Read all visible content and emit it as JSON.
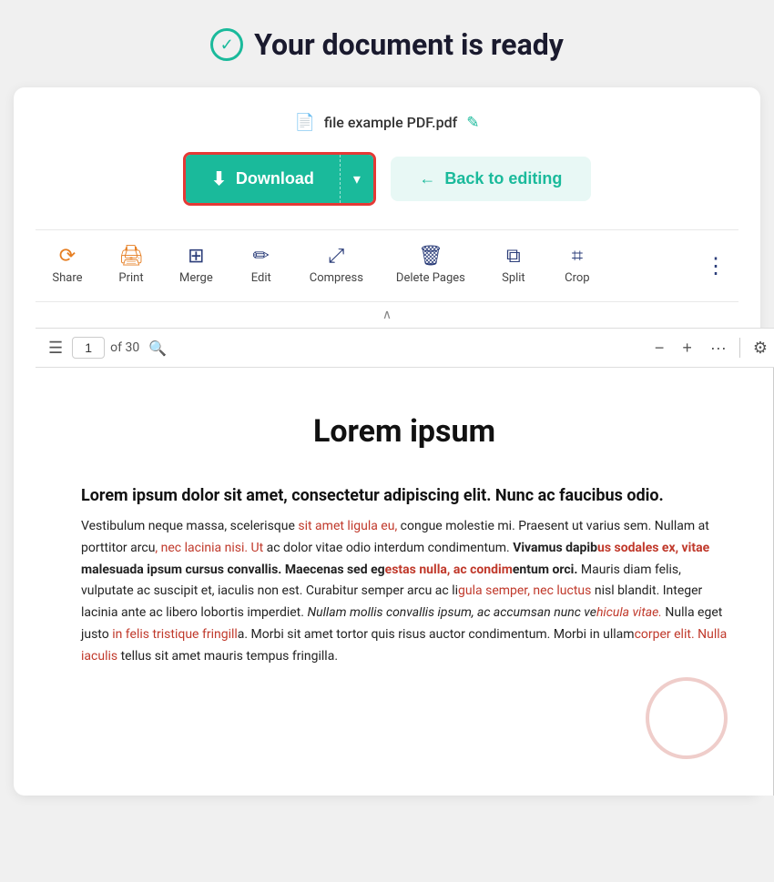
{
  "page": {
    "title": "Your document is ready"
  },
  "file": {
    "name": "file example PDF.pdf"
  },
  "buttons": {
    "download": "Download",
    "back_to_editing": "Back to editing"
  },
  "toolbar": {
    "items": [
      {
        "id": "share",
        "label": "Share",
        "icon_class": "share"
      },
      {
        "id": "print",
        "label": "Print",
        "icon_class": "print"
      },
      {
        "id": "merge",
        "label": "Merge",
        "icon_class": "merge"
      },
      {
        "id": "edit",
        "label": "Edit",
        "icon_class": "edit"
      },
      {
        "id": "compress",
        "label": "Compress",
        "icon_class": "compress"
      },
      {
        "id": "delete-pages",
        "label": "Delete Pages",
        "icon_class": "delete-pages"
      },
      {
        "id": "split",
        "label": "Split",
        "icon_class": "split"
      },
      {
        "id": "crop",
        "label": "Crop",
        "icon_class": "crop"
      }
    ]
  },
  "pdf_viewer": {
    "current_page": "1",
    "total_pages": "of 30",
    "content": {
      "title": "Lorem ipsum",
      "section_heading": "Lorem ipsum dolor sit amet, consectetur adipiscing elit. Nunc ac faucibus odio.",
      "paragraph": "Vestibulum neque massa, scelerisque sit amet ligula eu, congue molestie mi. Praesent ut varius sem. Nullam at porttitor arcu, nec lacinia nisi. Ut ac dolor vitae odio interdum condimentum. Vivamus dapibus sodales ex, vitae malesuada ipsum cursus convallis. Maecenas sed egestas nulla, ac condimentum orci. Mauris diam felis, vulputate ac suscipit et, iaculis non est. Curabitur semper arcu ac ligula semper, nec luctus nisl blandit. Integer lacinia ante ac libero lobortis imperdiet. Nullam mollis convallis ipsum, ac accumsan nunc vehicula vitae. Nulla eget justo in felis tristique fringilla. Morbi sit amet tortor quis risus auctor condimentum. Morbi in ullamcorper elit. Nulla iaculis tellus sit amet mauris tempus fringilla."
    }
  }
}
